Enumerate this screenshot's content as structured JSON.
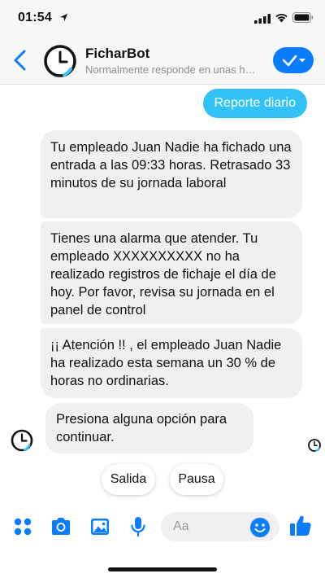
{
  "status_bar": {
    "time": "01:54",
    "icons": [
      "location-arrow-icon",
      "signal-icon",
      "wifi-icon",
      "battery-icon"
    ]
  },
  "header": {
    "name": "FicharBot",
    "status": "Normalmente responde en unas horas",
    "back_icon": "chevron-left-icon",
    "avatar_icon": "clock-icon",
    "action_icon": "check-dropdown-icon"
  },
  "messages": {
    "outgoing": [
      "Reporte diario"
    ],
    "incoming": [
      "Tu empleado Juan Nadie ha fichado una entrada a las 09:33 horas. Retrasado 33 minutos de su jornada laboral",
      "Tienes una alarma que atender. Tu empleado XXXXXXXXXX no ha realizado registros de fichaje el día de hoy. Por favor, revisa su jornada en el panel de control",
      "¡¡ Atención !! , el empleado Juan Nadie ha realizado esta semana un 30 % de horas no ordinarias.",
      "Presiona alguna opción para continuar."
    ]
  },
  "quick_replies": [
    "Salida",
    "Pausa"
  ],
  "composer": {
    "placeholder": "Aa",
    "icons": [
      "grid-icon",
      "camera-icon",
      "image-icon",
      "microphone-icon",
      "emoji-icon",
      "thumbs-up-icon"
    ]
  },
  "colors": {
    "accent": "#0a7cff",
    "outgoing_bubble": "#32c2f6",
    "incoming_bubble": "#f0f0f0",
    "header_bg": "#f7f7f7"
  }
}
